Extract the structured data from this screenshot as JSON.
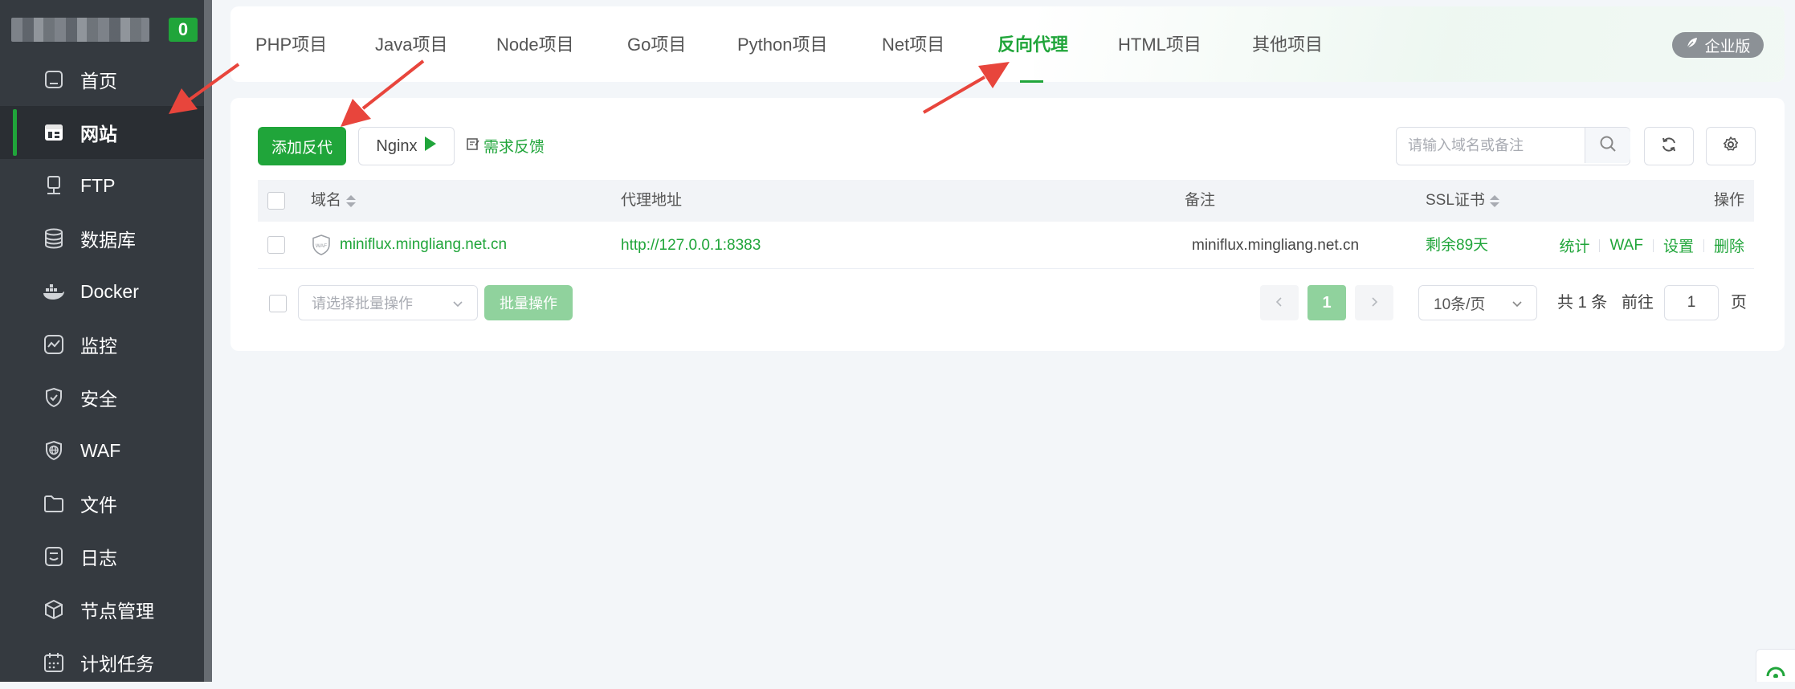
{
  "sidebar": {
    "badge": "0",
    "items": [
      {
        "label": "首页",
        "icon": "home-icon"
      },
      {
        "label": "网站",
        "icon": "website-icon",
        "active": true
      },
      {
        "label": "FTP",
        "icon": "ftp-icon"
      },
      {
        "label": "数据库",
        "icon": "database-icon"
      },
      {
        "label": "Docker",
        "icon": "docker-icon"
      },
      {
        "label": "监控",
        "icon": "monitor-icon"
      },
      {
        "label": "安全",
        "icon": "shield-icon"
      },
      {
        "label": "WAF",
        "icon": "waf-icon"
      },
      {
        "label": "文件",
        "icon": "folder-icon"
      },
      {
        "label": "日志",
        "icon": "log-icon"
      },
      {
        "label": "节点管理",
        "icon": "node-icon"
      },
      {
        "label": "计划任务",
        "icon": "calendar-icon"
      }
    ]
  },
  "tabs": [
    {
      "label": "PHP项目"
    },
    {
      "label": "Java项目"
    },
    {
      "label": "Node项目"
    },
    {
      "label": "Go项目"
    },
    {
      "label": "Python项目"
    },
    {
      "label": "Net项目"
    },
    {
      "label": "反向代理",
      "active": true
    },
    {
      "label": "HTML项目"
    },
    {
      "label": "其他项目"
    }
  ],
  "enterprise_badge": "企业版",
  "toolbar": {
    "add_label": "添加反代",
    "nginx_label": "Nginx",
    "feedback_label": "需求反馈",
    "search_placeholder": "请输入域名或备注"
  },
  "table": {
    "columns": [
      "域名",
      "代理地址",
      "备注",
      "SSL证书",
      "操作"
    ],
    "rows": [
      {
        "domain": "miniflux.mingliang.net.cn",
        "proxy": "http://127.0.0.1:8383",
        "remark": "miniflux.mingliang.net.cn",
        "ssl": "剩余89天",
        "actions": [
          "统计",
          "WAF",
          "设置",
          "删除"
        ]
      }
    ]
  },
  "footer": {
    "batch_placeholder": "请选择批量操作",
    "batch_button": "批量操作",
    "current_page": "1",
    "page_size": "10条/页",
    "total_prefix": "共",
    "total_count": "1",
    "total_suffix": "条",
    "goto_label": "前往",
    "goto_value": "1",
    "page_suffix": "页"
  },
  "colors": {
    "sidebar_bg": "#353a40",
    "accent": "#20a53a",
    "arrow": "#e8453c"
  }
}
